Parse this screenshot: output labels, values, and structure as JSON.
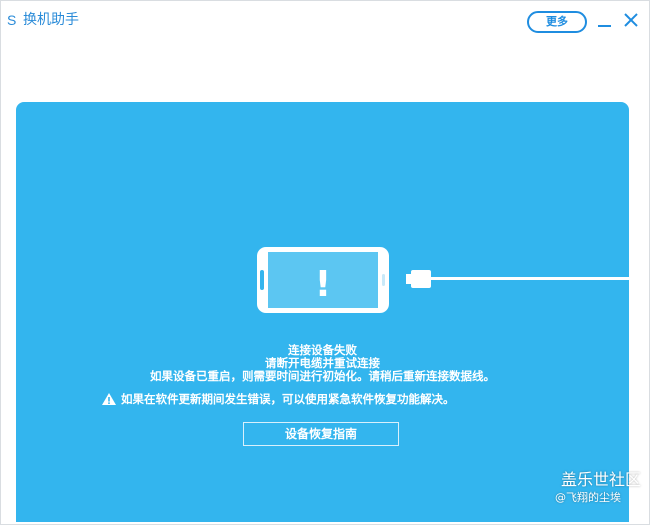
{
  "app": {
    "logo": "S",
    "title": "换机助手"
  },
  "toolbar": {
    "more_label": "更多"
  },
  "message": {
    "line1": "连接设备失败",
    "line2": "请断开电缆并重试连接",
    "line3": "如果设备已重启，则需要时间进行初始化。请稍后重新连接数据线。",
    "warning": "如果在软件更新期间发生错误，可以使用紧急软件恢复功能解决。"
  },
  "phone": {
    "symbol": "!"
  },
  "guide_button": {
    "label": "设备恢复指南"
  },
  "watermark": {
    "line1": "盖乐世社区",
    "line2": "@飞翔的尘埃"
  },
  "colors": {
    "accent": "#1f8de0",
    "panel": "#33b5ee",
    "phone_screen": "#5cc6f2"
  }
}
